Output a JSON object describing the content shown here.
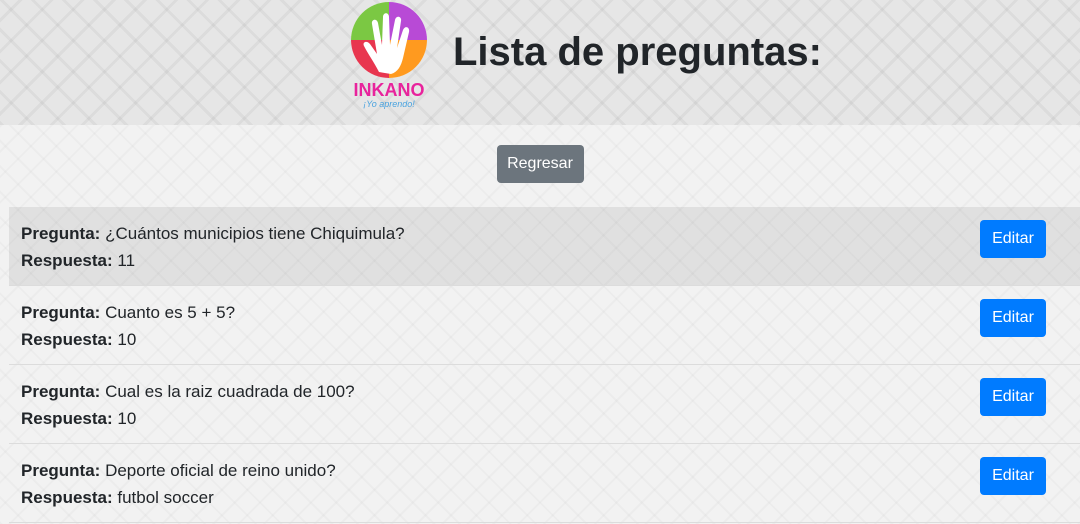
{
  "header": {
    "title": "Lista de preguntas:",
    "logo_brand": "INKANO",
    "logo_tagline": "¡Yo aprendo!"
  },
  "actions": {
    "back_label": "Regresar"
  },
  "labels": {
    "question": "Pregunta:",
    "answer": "Respuesta:",
    "edit": "Editar"
  },
  "questions": [
    {
      "question": "¿Cuántos municipios tiene Chiquimula?",
      "answer": "11"
    },
    {
      "question": "Cuanto es 5 + 5?",
      "answer": "10"
    },
    {
      "question": "Cual es la raiz cuadrada de 100?",
      "answer": "10"
    },
    {
      "question": "Deporte oficial de reino unido?",
      "answer": "futbol soccer"
    }
  ],
  "colors": {
    "primary": "#007bff",
    "secondary": "#6c757d"
  }
}
